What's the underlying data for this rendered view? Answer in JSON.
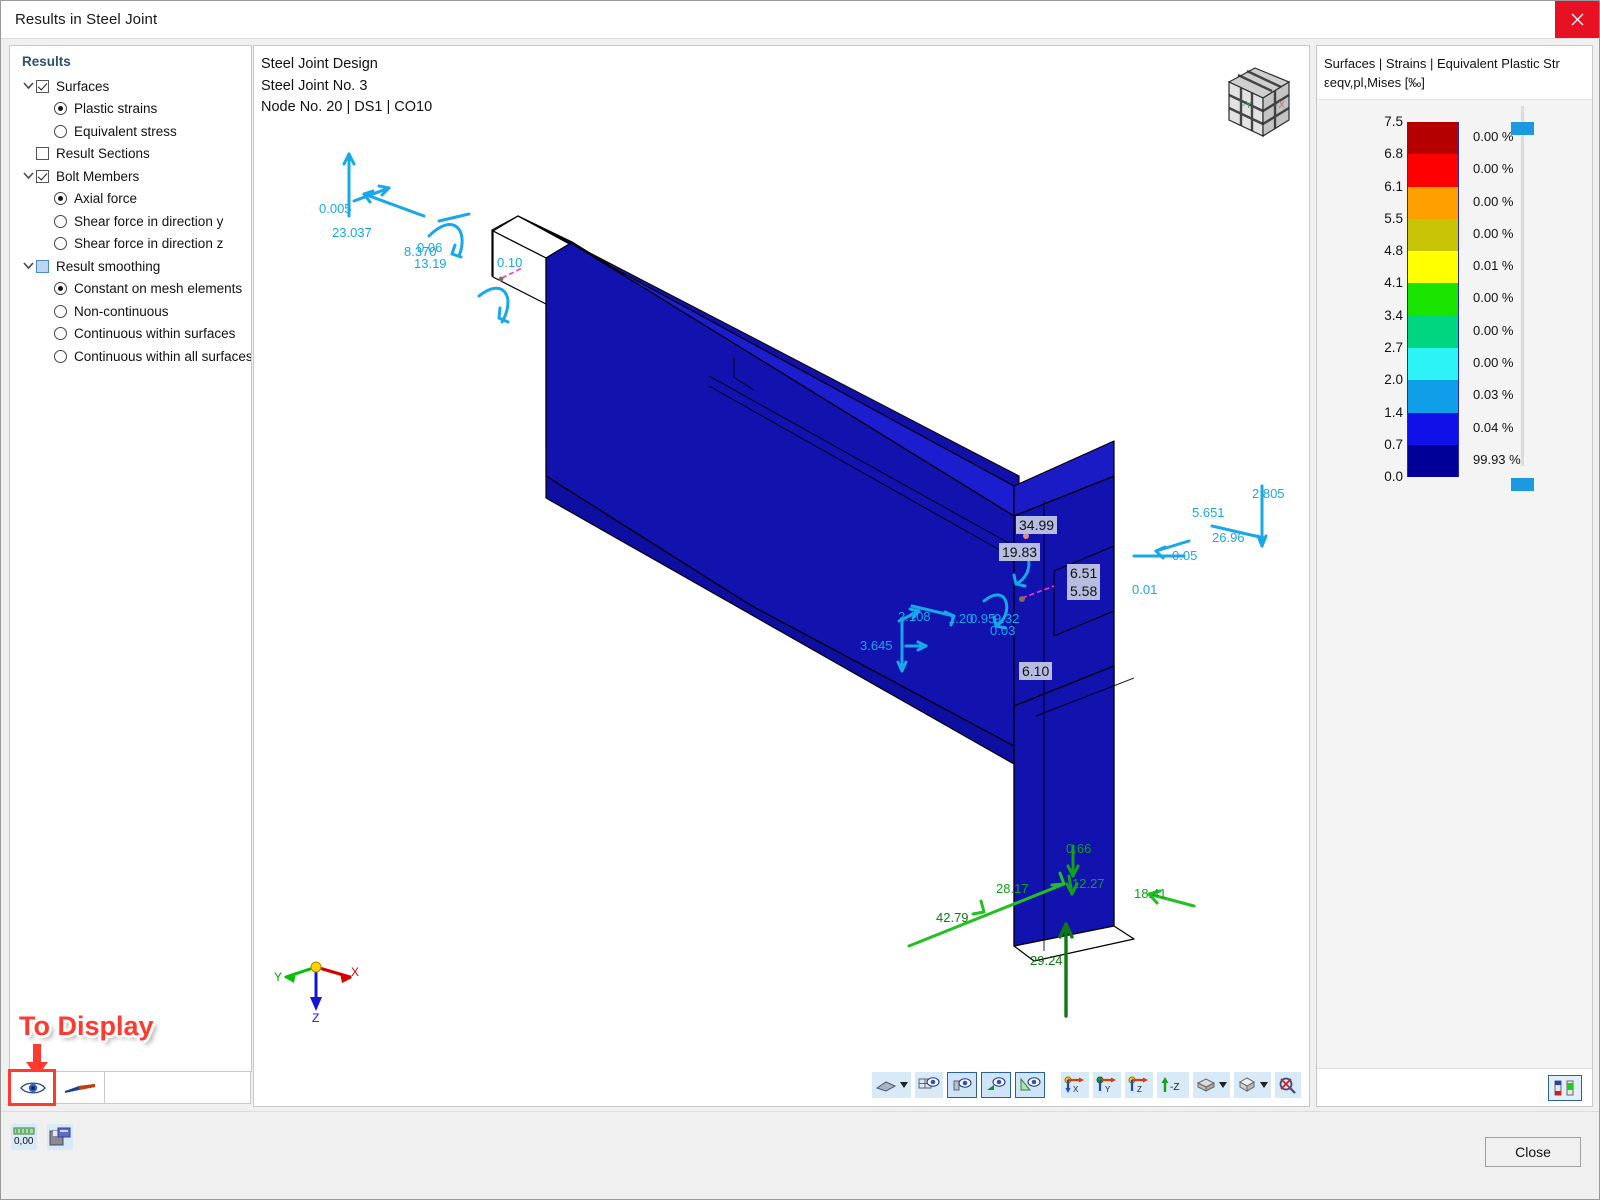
{
  "window": {
    "title": "Results in Steel Joint",
    "close_icon": "close-icon"
  },
  "left_panel": {
    "header": "Results",
    "tree": [
      {
        "label": "Surfaces",
        "type": "checkbox",
        "state": "checked",
        "level": 0,
        "expander": "chevron-down-icon"
      },
      {
        "label": "Plastic strains",
        "type": "radio",
        "state": "on",
        "level": 1
      },
      {
        "label": "Equivalent stress",
        "type": "radio",
        "state": "off",
        "level": 1
      },
      {
        "label": "Result Sections",
        "type": "checkbox",
        "state": "unchecked",
        "level": 0
      },
      {
        "label": "Bolt Members",
        "type": "checkbox",
        "state": "checked",
        "level": 0,
        "expander": "chevron-down-icon"
      },
      {
        "label": "Axial force",
        "type": "radio",
        "state": "on",
        "level": 1
      },
      {
        "label": "Shear force in direction y",
        "type": "radio",
        "state": "off",
        "level": 1
      },
      {
        "label": "Shear force in direction z",
        "type": "radio",
        "state": "off",
        "level": 1
      },
      {
        "label": "Result smoothing",
        "type": "checkbox",
        "state": "partial",
        "level": 0,
        "expander": "chevron-down-icon"
      },
      {
        "label": "Constant on mesh elements",
        "type": "radio",
        "state": "on",
        "level": 1
      },
      {
        "label": "Non-continuous",
        "type": "radio",
        "state": "off",
        "level": 1
      },
      {
        "label": "Continuous within surfaces",
        "type": "radio",
        "state": "off",
        "level": 1
      },
      {
        "label": "Continuous within all surfaces",
        "type": "radio",
        "state": "off",
        "level": 1
      }
    ],
    "annotation": {
      "text": "To Display",
      "color": "#ff3b30"
    },
    "bottom_tools": [
      {
        "name": "show-hide-eye-button",
        "icon": "eye-icon",
        "highlighted": true
      },
      {
        "name": "result-diagram-button",
        "icon": "result-diagram-icon",
        "highlighted": false
      }
    ],
    "filter_value": ""
  },
  "viewport": {
    "title_lines": "Steel Joint Design\nSteel Joint No. 3\nNode No. 20 | DS1 | CO10",
    "nav_cube": {
      "face_left": "-Y",
      "face_right": "-X"
    },
    "axes": {
      "x": "X",
      "y": "Y",
      "z": "Z"
    },
    "model_labels": {
      "bolt_forces_cyan": [
        "0.005",
        "23.037",
        "8.370",
        "13.19",
        "0.06",
        "0.10",
        "2.108",
        "3.645",
        "1.20",
        "0.95",
        "9.32",
        "0.03",
        "0.01",
        "0.05",
        "5.651",
        "26.96",
        "2.805"
      ],
      "boxed_values": [
        "34.99",
        "19.83",
        "6.51",
        "5.58",
        "6.10"
      ],
      "support_reactions_green": [
        "0.66",
        "12.27",
        "28.17",
        "18.41",
        "42.79",
        "29.24"
      ]
    },
    "toolbar": [
      {
        "name": "render-mode-button",
        "icon": "surface-render-icon",
        "dropdown": true,
        "selected": false
      },
      {
        "name": "show-mesh-button",
        "icon": "mesh-eye-icon",
        "dropdown": false,
        "selected": false
      },
      {
        "name": "show-supports-button",
        "icon": "support-eye-icon",
        "dropdown": false,
        "selected": true
      },
      {
        "name": "show-loads-button",
        "icon": "load-eye-icon",
        "dropdown": false,
        "selected": true
      },
      {
        "name": "show-results-button",
        "icon": "results-eye-icon",
        "dropdown": false,
        "selected": true
      },
      {
        "name": "view-in-x-button",
        "icon": "axis-x-icon",
        "dropdown": false,
        "selected": false
      },
      {
        "name": "view-in-y-button",
        "icon": "axis-y-icon",
        "dropdown": false,
        "selected": false
      },
      {
        "name": "view-in-z-button",
        "icon": "axis-z-icon",
        "dropdown": false,
        "selected": false
      },
      {
        "name": "view-negative-z-button",
        "icon": "axis-minus-z-icon",
        "dropdown": false,
        "selected": false
      },
      {
        "name": "view-preset-button",
        "icon": "box-view-icon",
        "dropdown": true,
        "selected": false
      },
      {
        "name": "perspective-button",
        "icon": "cube-view-icon",
        "dropdown": true,
        "selected": false
      },
      {
        "name": "zoom-reset-button",
        "icon": "zoom-reset-icon",
        "dropdown": false,
        "selected": false
      }
    ]
  },
  "legend": {
    "header_line1": "Surfaces | Strains | Equivalent Plastic Str",
    "header_line2": "εeqv,pl,Mises [‰]",
    "scale_settings_icon": "color-scale-settings-icon",
    "chart_data": {
      "type": "bar",
      "title": "Surfaces | Strains | Equivalent Plastic Strain",
      "ylabel": "εeqv,pl,Mises [‰]",
      "tick_labels": [
        "7.5",
        "6.8",
        "6.1",
        "5.5",
        "4.8",
        "4.1",
        "3.4",
        "2.7",
        "2.0",
        "1.4",
        "0.7",
        "0.0"
      ],
      "bands": [
        {
          "from": "6.8",
          "to": "7.5",
          "color": "#b40000",
          "percent": "0.00 %"
        },
        {
          "from": "6.1",
          "to": "6.8",
          "color": "#fe0000",
          "percent": "0.00 %"
        },
        {
          "from": "5.5",
          "to": "6.1",
          "color": "#ffa000",
          "percent": "0.00 %"
        },
        {
          "from": "4.8",
          "to": "5.5",
          "color": "#cac406",
          "percent": "0.00 %"
        },
        {
          "from": "4.1",
          "to": "4.8",
          "color": "#ffff00",
          "percent": "0.01 %"
        },
        {
          "from": "3.4",
          "to": "4.1",
          "color": "#18e400",
          "percent": "0.00 %"
        },
        {
          "from": "2.7",
          "to": "3.4",
          "color": "#00d680",
          "percent": "0.00 %"
        },
        {
          "from": "2.0",
          "to": "2.7",
          "color": "#2cf3f5",
          "percent": "0.00 %"
        },
        {
          "from": "1.4",
          "to": "2.0",
          "color": "#109ee8",
          "percent": "0.03 %"
        },
        {
          "from": "0.7",
          "to": "1.4",
          "color": "#1010e8",
          "percent": "0.04 %"
        },
        {
          "from": "0.0",
          "to": "0.7",
          "color": "#000099",
          "percent": "99.93 %"
        }
      ],
      "knob_color": "#1c9ae0"
    }
  },
  "status_bar": {
    "icons": [
      {
        "name": "precision-value-icon",
        "label": "0,00"
      },
      {
        "name": "export-results-icon",
        "label": ""
      }
    ],
    "close_button": "Close"
  }
}
